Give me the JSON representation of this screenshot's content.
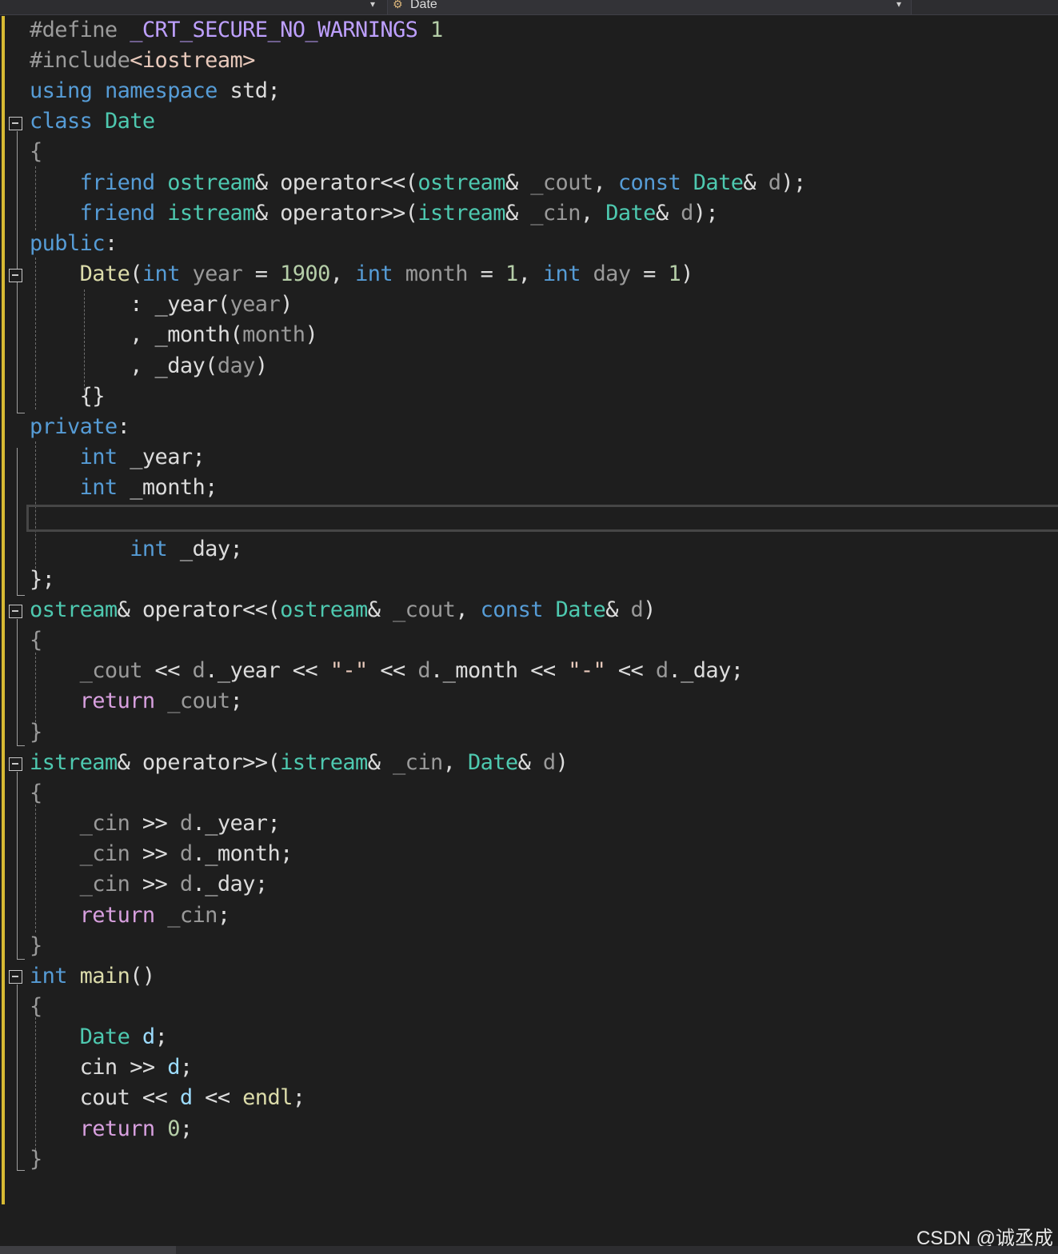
{
  "nav_bar": {
    "member_dropdown_label": "Date"
  },
  "code_lines": [
    [
      [
        "#define ",
        "pre"
      ],
      [
        "_CRT_SECURE_NO_WARNINGS",
        "mac"
      ],
      [
        " 1",
        "num"
      ]
    ],
    [
      [
        "#include",
        "pre"
      ],
      [
        "<iostream>",
        "str"
      ]
    ],
    [
      [
        "using",
        "kw"
      ],
      [
        " ",
        "plain"
      ],
      [
        "namespace",
        "kw"
      ],
      [
        " std;",
        "plain"
      ]
    ],
    [
      [
        "class",
        "kw"
      ],
      [
        " ",
        "plain"
      ],
      [
        "Date",
        "ty"
      ]
    ],
    [
      [
        "{",
        "par"
      ]
    ],
    [
      [
        "    ",
        "plain"
      ],
      [
        "friend",
        "kw"
      ],
      [
        " ",
        "plain"
      ],
      [
        "ostream",
        "ty"
      ],
      [
        "& operator<<(",
        "plain"
      ],
      [
        "ostream",
        "ty"
      ],
      [
        "& ",
        "plain"
      ],
      [
        "_cout",
        "par"
      ],
      [
        ", ",
        "plain"
      ],
      [
        "const",
        "kw"
      ],
      [
        " ",
        "plain"
      ],
      [
        "Date",
        "ty"
      ],
      [
        "& ",
        "plain"
      ],
      [
        "d",
        "par"
      ],
      [
        ");",
        "plain"
      ]
    ],
    [
      [
        "    ",
        "plain"
      ],
      [
        "friend",
        "kw"
      ],
      [
        " ",
        "plain"
      ],
      [
        "istream",
        "ty"
      ],
      [
        "& operator>>(",
        "plain"
      ],
      [
        "istream",
        "ty"
      ],
      [
        "& ",
        "plain"
      ],
      [
        "_cin",
        "par"
      ],
      [
        ", ",
        "plain"
      ],
      [
        "Date",
        "ty"
      ],
      [
        "& ",
        "plain"
      ],
      [
        "d",
        "par"
      ],
      [
        ");",
        "plain"
      ]
    ],
    [
      [
        "public",
        "kw"
      ],
      [
        ":",
        "plain"
      ]
    ],
    [
      [
        "    ",
        "plain"
      ],
      [
        "Date",
        "fn"
      ],
      [
        "(",
        "plain"
      ],
      [
        "int",
        "kw"
      ],
      [
        " ",
        "plain"
      ],
      [
        "year",
        "par"
      ],
      [
        " = ",
        "plain"
      ],
      [
        "1900",
        "num"
      ],
      [
        ", ",
        "plain"
      ],
      [
        "int",
        "kw"
      ],
      [
        " ",
        "plain"
      ],
      [
        "month",
        "par"
      ],
      [
        " = ",
        "plain"
      ],
      [
        "1",
        "num"
      ],
      [
        ", ",
        "plain"
      ],
      [
        "int",
        "kw"
      ],
      [
        " ",
        "plain"
      ],
      [
        "day",
        "par"
      ],
      [
        " = ",
        "plain"
      ],
      [
        "1",
        "num"
      ],
      [
        ")",
        "plain"
      ]
    ],
    [
      [
        "        : _year(",
        "plain"
      ],
      [
        "year",
        "par"
      ],
      [
        ")",
        "plain"
      ]
    ],
    [
      [
        "        , _month(",
        "plain"
      ],
      [
        "month",
        "par"
      ],
      [
        ")",
        "plain"
      ]
    ],
    [
      [
        "        , _day(",
        "plain"
      ],
      [
        "day",
        "par"
      ],
      [
        ")",
        "plain"
      ]
    ],
    [
      [
        "    {}",
        "plain"
      ]
    ],
    [
      [
        "private",
        "kw"
      ],
      [
        ":",
        "plain"
      ]
    ],
    [
      [
        "    ",
        "plain"
      ],
      [
        "int",
        "kw"
      ],
      [
        " _year;",
        "plain"
      ]
    ],
    [
      [
        "    ",
        "plain"
      ],
      [
        "int",
        "kw"
      ],
      [
        " _month;",
        "plain"
      ]
    ],
    [],
    [
      [
        "        ",
        "plain"
      ],
      [
        "int",
        "kw"
      ],
      [
        " _day;",
        "plain"
      ]
    ],
    [
      [
        "};",
        "plain"
      ]
    ],
    [
      [
        "ostream",
        "ty"
      ],
      [
        "& operator<<(",
        "plain"
      ],
      [
        "ostream",
        "ty"
      ],
      [
        "& ",
        "plain"
      ],
      [
        "_cout",
        "par"
      ],
      [
        ", ",
        "plain"
      ],
      [
        "const",
        "kw"
      ],
      [
        " ",
        "plain"
      ],
      [
        "Date",
        "ty"
      ],
      [
        "& ",
        "plain"
      ],
      [
        "d",
        "par"
      ],
      [
        ")",
        "plain"
      ]
    ],
    [
      [
        "{",
        "par"
      ]
    ],
    [
      [
        "    ",
        "plain"
      ],
      [
        "_cout",
        "par"
      ],
      [
        " << ",
        "plain"
      ],
      [
        "d",
        "par"
      ],
      [
        ".",
        "plain"
      ],
      [
        "_year",
        "plain"
      ],
      [
        " << ",
        "plain"
      ],
      [
        "\"-\"",
        "str"
      ],
      [
        " << ",
        "plain"
      ],
      [
        "d",
        "par"
      ],
      [
        ".",
        "plain"
      ],
      [
        "_month",
        "plain"
      ],
      [
        " << ",
        "plain"
      ],
      [
        "\"-\"",
        "str"
      ],
      [
        " << ",
        "plain"
      ],
      [
        "d",
        "par"
      ],
      [
        ".",
        "plain"
      ],
      [
        "_day",
        "plain"
      ],
      [
        ";",
        "plain"
      ]
    ],
    [
      [
        "    ",
        "plain"
      ],
      [
        "return",
        "ctl"
      ],
      [
        " ",
        "plain"
      ],
      [
        "_cout",
        "par"
      ],
      [
        ";",
        "plain"
      ]
    ],
    [
      [
        "}",
        "par"
      ]
    ],
    [
      [
        "istream",
        "ty"
      ],
      [
        "& operator>>(",
        "plain"
      ],
      [
        "istream",
        "ty"
      ],
      [
        "& ",
        "plain"
      ],
      [
        "_cin",
        "par"
      ],
      [
        ", ",
        "plain"
      ],
      [
        "Date",
        "ty"
      ],
      [
        "& ",
        "plain"
      ],
      [
        "d",
        "par"
      ],
      [
        ")",
        "plain"
      ]
    ],
    [
      [
        "{",
        "par"
      ]
    ],
    [
      [
        "    ",
        "plain"
      ],
      [
        "_cin",
        "par"
      ],
      [
        " >> ",
        "plain"
      ],
      [
        "d",
        "par"
      ],
      [
        ".",
        "plain"
      ],
      [
        "_year",
        "plain"
      ],
      [
        ";",
        "plain"
      ]
    ],
    [
      [
        "    ",
        "plain"
      ],
      [
        "_cin",
        "par"
      ],
      [
        " >> ",
        "plain"
      ],
      [
        "d",
        "par"
      ],
      [
        ".",
        "plain"
      ],
      [
        "_month",
        "plain"
      ],
      [
        ";",
        "plain"
      ]
    ],
    [
      [
        "    ",
        "plain"
      ],
      [
        "_cin",
        "par"
      ],
      [
        " >> ",
        "plain"
      ],
      [
        "d",
        "par"
      ],
      [
        ".",
        "plain"
      ],
      [
        "_day",
        "plain"
      ],
      [
        ";",
        "plain"
      ]
    ],
    [
      [
        "    ",
        "plain"
      ],
      [
        "return",
        "ctl"
      ],
      [
        " ",
        "plain"
      ],
      [
        "_cin",
        "par"
      ],
      [
        ";",
        "plain"
      ]
    ],
    [
      [
        "}",
        "par"
      ]
    ],
    [
      [
        "int",
        "kw"
      ],
      [
        " ",
        "plain"
      ],
      [
        "main",
        "fn"
      ],
      [
        "()",
        "plain"
      ]
    ],
    [
      [
        "{",
        "par"
      ]
    ],
    [
      [
        "    ",
        "plain"
      ],
      [
        "Date",
        "ty"
      ],
      [
        " ",
        "plain"
      ],
      [
        "d",
        "var"
      ],
      [
        ";",
        "plain"
      ]
    ],
    [
      [
        "    cin >> ",
        "plain"
      ],
      [
        "d",
        "var"
      ],
      [
        ";",
        "plain"
      ]
    ],
    [
      [
        "    cout << ",
        "plain"
      ],
      [
        "d",
        "var"
      ],
      [
        " << ",
        "plain"
      ],
      [
        "endl",
        "fn"
      ],
      [
        ";",
        "plain"
      ]
    ],
    [
      [
        "    ",
        "plain"
      ],
      [
        "return",
        "ctl"
      ],
      [
        " ",
        "plain"
      ],
      [
        "0",
        "num"
      ],
      [
        ";",
        "plain"
      ]
    ],
    [
      [
        "}",
        "par"
      ]
    ]
  ],
  "watermark": "CSDN @诚丞成"
}
